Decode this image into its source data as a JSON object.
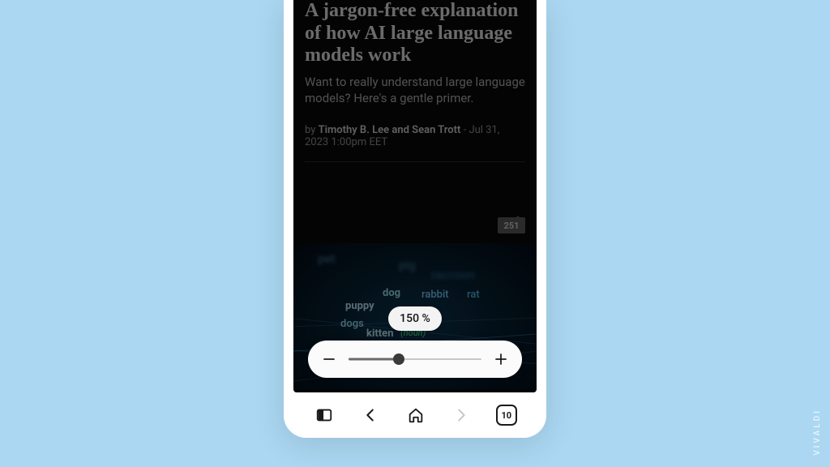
{
  "article": {
    "title": "A jargon-free explanation of how AI large language models work",
    "subtitle": "Want to really understand large language models? Here's a gentle primer.",
    "byline_prefix": "by ",
    "authors": "Timothy B. Lee and Sean Trott",
    "byline_sep": " - ",
    "date": "Jul 31, 2023 1:00pm EET",
    "comment_count": "251"
  },
  "hero_words": {
    "pet": "pet",
    "pig": "pig",
    "raccoon": "raccoon",
    "dog": "dog",
    "rabbit": "rabbit",
    "rat": "rat",
    "puppy": "puppy",
    "dogs": "dogs",
    "kitten": "kitten",
    "noun": "(noun)"
  },
  "zoom": {
    "display": "150 %",
    "percent": 38
  },
  "toolbar": {
    "tab_count": "10"
  },
  "brand": "VIVALDI"
}
